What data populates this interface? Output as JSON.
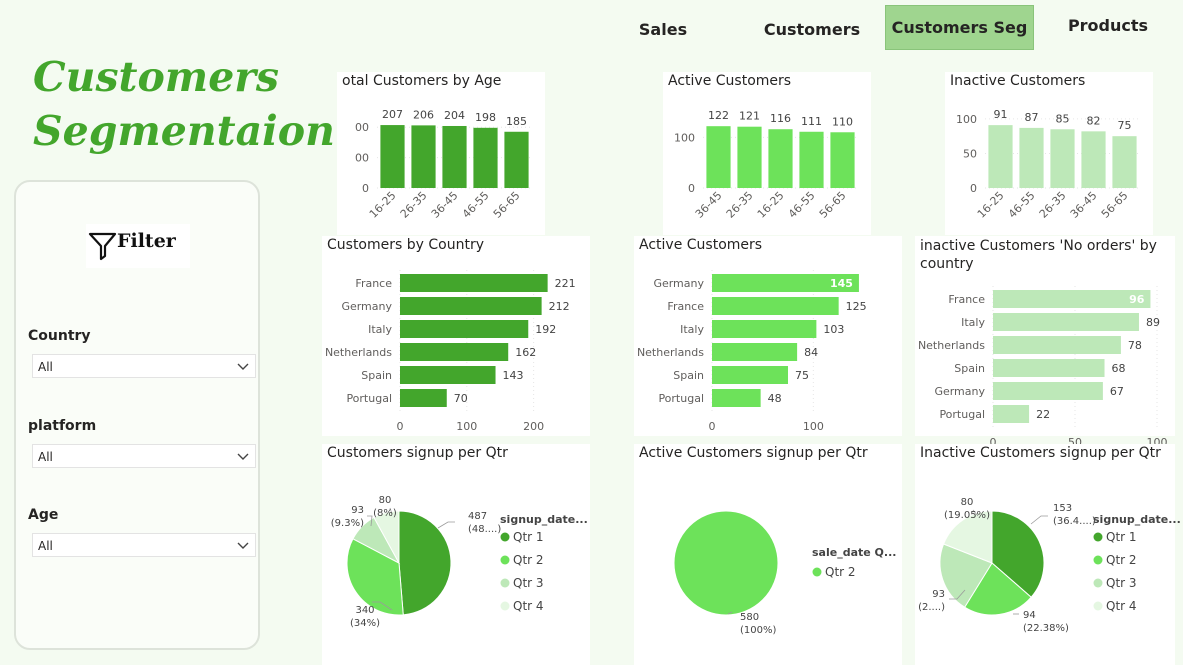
{
  "nav": {
    "sales": "Sales",
    "customers": "Customers",
    "customers_seg": "Customers Seg",
    "products": "Products"
  },
  "page_title": "Customers Segmentaion",
  "filter": {
    "title": "Filter",
    "country_label": "Country",
    "country_value": "All",
    "platform_label": "platform",
    "platform_value": "All",
    "age_label": "Age",
    "age_value": "All"
  },
  "colors": {
    "dark_green": "#43a62c",
    "light_green": "#6de25a",
    "pale_green": "#bde8b8",
    "very_pale_green": "#e5f7e2",
    "active_tab": "#9fd58f"
  },
  "chart_data": [
    {
      "id": "total_by_age",
      "type": "bar",
      "title": "otal Customers by Age",
      "color": "#43a62c",
      "categories": [
        "16-25",
        "26-35",
        "36-45",
        "46-55",
        "56-65"
      ],
      "values": [
        207,
        206,
        204,
        198,
        185
      ],
      "ylim": [
        0,
        250
      ],
      "yticks": [
        0,
        100,
        200
      ],
      "ytick_labels": [
        "0",
        "00",
        "00"
      ]
    },
    {
      "id": "active_by_age",
      "type": "bar",
      "title": "Active Customers",
      "color": "#6de25a",
      "categories": [
        "36-45",
        "26-35",
        "16-25",
        "46-55",
        "56-65"
      ],
      "values": [
        122,
        121,
        116,
        111,
        110
      ],
      "ylim": [
        0,
        150
      ],
      "yticks": [
        0,
        100
      ],
      "ytick_labels": [
        "0",
        "100"
      ]
    },
    {
      "id": "inactive_by_age",
      "type": "bar",
      "title": "Inactive Customers",
      "color": "#bde8b8",
      "categories": [
        "16-25",
        "46-55",
        "26-35",
        "36-45",
        "56-65"
      ],
      "values": [
        91,
        87,
        85,
        82,
        75
      ],
      "ylim": [
        0,
        110
      ],
      "yticks": [
        0,
        50,
        100
      ],
      "ytick_labels": [
        "0",
        "50",
        "100"
      ]
    },
    {
      "id": "by_country",
      "type": "hbar",
      "title": "Customers by Country",
      "color": "#43a62c",
      "categories": [
        "France",
        "Germany",
        "Italy",
        "Netherlands",
        "Spain",
        "Portugal"
      ],
      "values": [
        221,
        212,
        192,
        162,
        143,
        70
      ],
      "xlim": [
        0,
        250
      ],
      "xticks": [
        0,
        100,
        200
      ],
      "ytick_labels": [
        "0",
        "100",
        "200"
      ]
    },
    {
      "id": "active_by_country",
      "type": "hbar",
      "title": "Active Customers",
      "color": "#6de25a",
      "categories": [
        "Germany",
        "France",
        "Italy",
        "Netherlands",
        "Spain",
        "Portugal"
      ],
      "values": [
        145,
        125,
        103,
        84,
        75,
        48
      ],
      "xlim": [
        0,
        150
      ],
      "xticks": [
        0,
        100
      ],
      "ytick_labels": [
        "0",
        "100"
      ]
    },
    {
      "id": "inactive_by_country",
      "type": "hbar",
      "title": "inactive Customers 'No orders' by country",
      "color": "#bde8b8",
      "categories": [
        "France",
        "Italy",
        "Netherlands",
        "Spain",
        "Germany",
        "Portugal"
      ],
      "values": [
        96,
        89,
        78,
        68,
        67,
        22
      ],
      "xlim": [
        0,
        100
      ],
      "xticks": [
        0,
        50,
        100
      ],
      "ytick_labels": [
        "0",
        "50",
        "100"
      ]
    },
    {
      "id": "signup_qtr",
      "type": "pie",
      "title": "Customers signup per Qtr",
      "legend_title": "signup_date...",
      "slices": [
        {
          "label": "Qtr 1",
          "value": 487,
          "data_label": "487",
          "pct_label": "(48....)",
          "color": "#43a62c"
        },
        {
          "label": "Qtr 2",
          "value": 340,
          "data_label": "340",
          "pct_label": "(34%)",
          "color": "#6de25a"
        },
        {
          "label": "Qtr 3",
          "value": 93,
          "data_label": "93",
          "pct_label": "(9.3%)",
          "color": "#bde8b8"
        },
        {
          "label": "Qtr 4",
          "value": 80,
          "data_label": "80",
          "pct_label": "(8%)",
          "color": "#e5f7e2"
        }
      ]
    },
    {
      "id": "active_signup_qtr",
      "type": "pie",
      "title": "Active Customers signup per Qtr",
      "legend_title": "sale_date Q...",
      "slices": [
        {
          "label": "Qtr 2",
          "value": 580,
          "data_label": "580",
          "pct_label": "(100%)",
          "color": "#6de25a"
        }
      ]
    },
    {
      "id": "inactive_signup_qtr",
      "type": "pie",
      "title": "Inactive Customers signup per Qtr",
      "legend_title": "signup_date...",
      "slices": [
        {
          "label": "Qtr 1",
          "value": 153,
          "data_label": "153",
          "pct_label": "(36.4....)",
          "color": "#43a62c"
        },
        {
          "label": "Qtr 2",
          "value": 94,
          "data_label": "94",
          "pct_label": "(22.38%)",
          "color": "#6de25a"
        },
        {
          "label": "Qtr 3",
          "value": 93,
          "data_label": "93",
          "pct_label": "(2....)",
          "color": "#bde8b8"
        },
        {
          "label": "Qtr 4",
          "value": 80,
          "data_label": "80",
          "pct_label": "(19.05%)",
          "color": "#e5f7e2"
        }
      ]
    }
  ]
}
